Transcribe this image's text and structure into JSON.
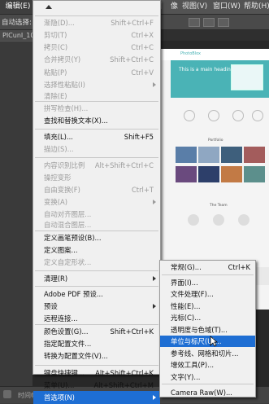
{
  "menubar": {
    "edit": "编辑(E)",
    "view_partial": "图",
    "image_partial": "像",
    "view": "视图(V)",
    "window": "窗口(W)",
    "help": "帮助(H)"
  },
  "options_bar": {
    "auto_select": "自动选择:"
  },
  "tab": {
    "doc_title": "PICunI_102-"
  },
  "status": {
    "label": "时间帧"
  },
  "edit_menu": {
    "items": [
      {
        "label": "渐隐(D)...",
        "shortcut": "Shift+Ctrl+F",
        "disabled": true
      },
      {
        "label": "剪切(T)",
        "shortcut": "Ctrl+X",
        "disabled": true
      },
      {
        "label": "拷贝(C)",
        "shortcut": "Ctrl+C",
        "disabled": true
      },
      {
        "label": "合并拷贝(Y)",
        "shortcut": "Shift+Ctrl+C",
        "disabled": true
      },
      {
        "label": "粘贴(P)",
        "shortcut": "Ctrl+V",
        "disabled": true
      },
      {
        "label": "选择性粘贴(I)",
        "shortcut": "",
        "disabled": true,
        "submenu": true
      },
      {
        "label": "清除(E)",
        "shortcut": "",
        "disabled": true
      },
      {
        "label": "拼写检查(H)...",
        "shortcut": "",
        "disabled": true
      },
      {
        "label": "查找和替换文本(X)...",
        "shortcut": "",
        "disabled": false
      },
      {
        "label": "填充(L)...",
        "shortcut": "Shift+F5",
        "disabled": false
      },
      {
        "label": "描边(S)...",
        "shortcut": "",
        "disabled": true
      },
      {
        "label": "内容识别比例",
        "shortcut": "Alt+Shift+Ctrl+C",
        "disabled": true
      },
      {
        "label": "操控变形",
        "shortcut": "",
        "disabled": true
      },
      {
        "label": "自由变换(F)",
        "shortcut": "Ctrl+T",
        "disabled": true
      },
      {
        "label": "变换(A)",
        "shortcut": "",
        "disabled": true,
        "submenu": true
      },
      {
        "label": "自动对齐图层...",
        "shortcut": "",
        "disabled": true
      },
      {
        "label": "自动混合图层...",
        "shortcut": "",
        "disabled": true
      },
      {
        "label": "定义画笔预设(B)...",
        "shortcut": "",
        "disabled": false
      },
      {
        "label": "定义图案...",
        "shortcut": "",
        "disabled": false
      },
      {
        "label": "定义自定形状...",
        "shortcut": "",
        "disabled": true
      },
      {
        "label": "清理(R)",
        "shortcut": "",
        "disabled": false,
        "submenu": true
      },
      {
        "label": "Adobe PDF 预设...",
        "shortcut": "",
        "disabled": false
      },
      {
        "label": "预设",
        "shortcut": "",
        "disabled": false,
        "submenu": true
      },
      {
        "label": "远程连接...",
        "shortcut": "",
        "disabled": false
      },
      {
        "label": "颜色设置(G)...",
        "shortcut": "Shift+Ctrl+K",
        "disabled": false
      },
      {
        "label": "指定配置文件...",
        "shortcut": "",
        "disabled": false
      },
      {
        "label": "转换为配置文件(V)...",
        "shortcut": "",
        "disabled": false
      },
      {
        "label": "键盘快捷键...",
        "shortcut": "Alt+Shift+Ctrl+K",
        "disabled": false
      },
      {
        "label": "菜单(U)...",
        "shortcut": "Alt+Shift+Ctrl+M",
        "disabled": false
      },
      {
        "label": "首选项(N)",
        "shortcut": "",
        "disabled": false,
        "submenu": true,
        "highlighted": true
      }
    ]
  },
  "prefs_menu": {
    "items": [
      {
        "label": "常规(G)...",
        "shortcut": "Ctrl+K"
      },
      {
        "label": "界面(I)...",
        "shortcut": ""
      },
      {
        "label": "文件处理(F)...",
        "shortcut": ""
      },
      {
        "label": "性能(E)...",
        "shortcut": ""
      },
      {
        "label": "光标(C)...",
        "shortcut": ""
      },
      {
        "label": "透明度与色域(T)...",
        "shortcut": ""
      },
      {
        "label": "单位与标尺(U)...",
        "shortcut": "",
        "highlighted": true
      },
      {
        "label": "参考线、网格和切片...",
        "shortcut": ""
      },
      {
        "label": "增效工具(P)...",
        "shortcut": ""
      },
      {
        "label": "文字(Y)...",
        "shortcut": ""
      },
      {
        "label": "Camera Raw(W)...",
        "shortcut": ""
      }
    ]
  },
  "doc_preview": {
    "brand": "PhotoBlox",
    "hero_heading": "This is a main heading",
    "section_portfolio": "Portfolio",
    "section_team": "The Team"
  },
  "colors": {
    "highlight": "#1e6ed3",
    "hero": "#4ab3b6"
  }
}
